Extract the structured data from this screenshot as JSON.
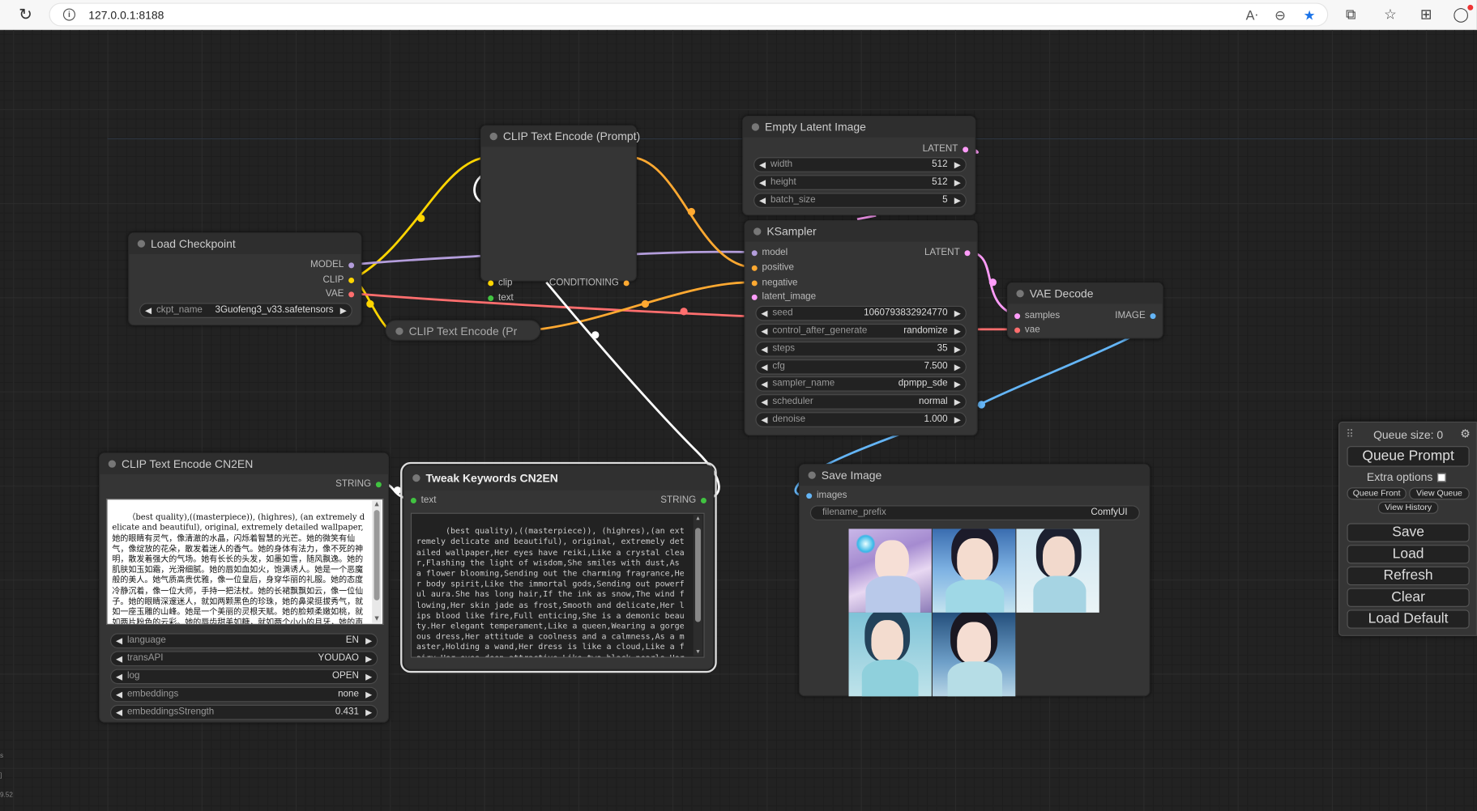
{
  "browser": {
    "url": "127.0.0.1:8188"
  },
  "nodes": {
    "clip_prompt": {
      "title": "CLIP Text Encode (Prompt)",
      "in_clip": "clip",
      "in_text": "text",
      "out": "CONDITIONING"
    },
    "empty_latent": {
      "title": "Empty Latent Image",
      "out": "LATENT",
      "widgets": [
        {
          "label": "width",
          "value": "512"
        },
        {
          "label": "height",
          "value": "512"
        },
        {
          "label": "batch_size",
          "value": "5"
        }
      ]
    },
    "load_checkpoint": {
      "title": "Load Checkpoint",
      "out_model": "MODEL",
      "out_clip": "CLIP",
      "out_vae": "VAE",
      "widget": {
        "label": "ckpt_name",
        "value": "3Guofeng3_v33.safetensors"
      }
    },
    "clip_collapsed": {
      "title": "CLIP Text Encode (Pr"
    },
    "ksampler": {
      "title": "KSampler",
      "in_model": "model",
      "in_positive": "positive",
      "in_negative": "negative",
      "in_latent": "latent_image",
      "out": "LATENT",
      "widgets": [
        {
          "label": "seed",
          "value": "1060793832924770"
        },
        {
          "label": "control_after_generate",
          "value": "randomize"
        },
        {
          "label": "steps",
          "value": "35"
        },
        {
          "label": "cfg",
          "value": "7.500"
        },
        {
          "label": "sampler_name",
          "value": "dpmpp_sde"
        },
        {
          "label": "scheduler",
          "value": "normal"
        },
        {
          "label": "denoise",
          "value": "1.000"
        }
      ]
    },
    "vae_decode": {
      "title": "VAE Decode",
      "in_samples": "samples",
      "in_vae": "vae",
      "out": "IMAGE"
    },
    "cn2en": {
      "title": "CLIP Text Encode CN2EN",
      "out": "STRING",
      "text": "（best quality),((masterpiece)), (highres), (an extremely delicate and beautiful), original, extremely detailed wallpaper,她的眼睛有灵气，像清澈的水晶，闪烁着智慧的光芒。她的微笑有仙气，像绽放的花朵，散发着迷人的香气。她的身体有法力，像不死的神明，散发着强大的气场。她有长长的头发，如墨如雪，随风飘逸。她的肌肤如玉如霜，光滑细腻。她的唇如血如火，饱满诱人。她是一个恶魔般的美人。她气质高贵优雅，像一位皇后，身穿华丽的礼服。她的态度冷静沉着，像一位大师，手持一把法杖。她的长裙飘飘如云，像一位仙子。她的眼睛深邃迷人，就如两颗黑色的珍珠，她的鼻梁挺拔秀气，就如一座玉雕的山峰。她是一个美丽的灵根天赋。她的脸颊柔嫩如桃，就如两片粉色的云彩。她的唇齿甜美如糖，就如两个小小的月牙，她的声音清脆如",
      "widgets": [
        {
          "label": "language",
          "value": "EN"
        },
        {
          "label": "transAPI",
          "value": "YOUDAO"
        },
        {
          "label": "log",
          "value": "OPEN"
        },
        {
          "label": "embeddings",
          "value": "none"
        },
        {
          "label": "embeddingsStrength",
          "value": "0.431"
        }
      ]
    },
    "tweak": {
      "title": "Tweak Keywords CN2EN",
      "in_text": "text",
      "out": "STRING",
      "text": "(best quality),((masterpiece)), (highres),(an extremely delicate and beautiful), original, extremely detailed wallpaper,Her eyes have reiki,Like a crystal clear,Flashing the light of wisdom,She smiles with dust,As a flower blooming,Sending out the charming fragrance,Her body spirit,Like the immortal gods,Sending out powerful aura.She has long hair,If the ink as snow,The wind flowing,Her skin jade as frost,Smooth and delicate,Her lips blood like fire,Full enticing,She is a demonic beauty.Her elegant temperament,Like a queen,Wearing a gorgeous dress,Her attitude a coolness and a calmness,As a master,Holding a wand,Her dress is like a cloud,Like a fairy.Her eyes deep attractive.Like two black pearls,Her nose delicate,As a jade mountain,She is a beautiful spirit talent.Her cheeks soft peach Like two pieces"
    },
    "save_image": {
      "title": "Save Image",
      "in_images": "images",
      "widget": {
        "label": "filename_prefix",
        "value": "ComfyUI"
      }
    }
  },
  "queue_panel": {
    "queue_size": "Queue size: 0",
    "queue_prompt": "Queue Prompt",
    "extra_options": "Extra options",
    "queue_front": "Queue Front",
    "view_queue": "View Queue",
    "view_history": "View History",
    "save": "Save",
    "load": "Load",
    "refresh": "Refresh",
    "clear": "Clear",
    "load_default": "Load Default"
  },
  "stats": [
    "s",
    "]",
    "9.52"
  ],
  "colors": {
    "clip": "#ffd500",
    "model": "#b39ddb",
    "vae": "#ff6e6e",
    "conditioning": "#ffa931",
    "latent": "#ff9cf9",
    "image": "#64b5f6",
    "string": "#ffffff",
    "string_pin": "#41c341"
  }
}
